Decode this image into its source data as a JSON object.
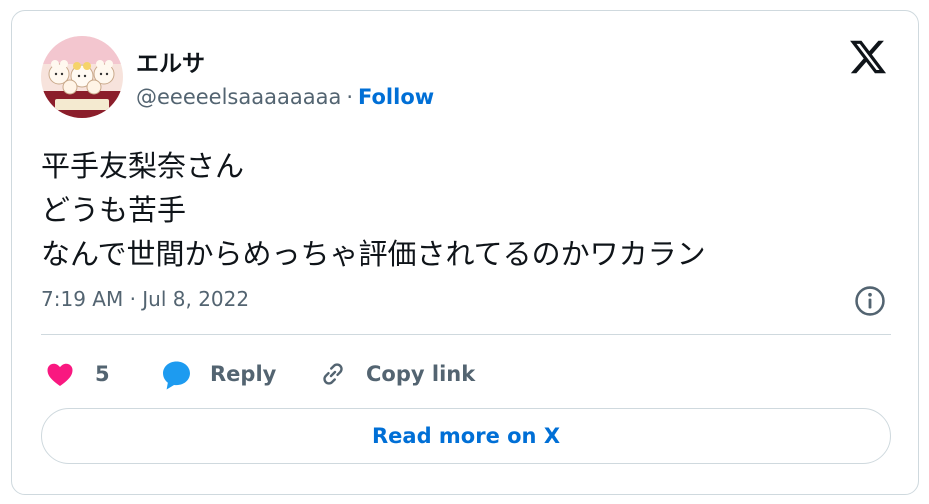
{
  "author": {
    "name": "エルサ",
    "handle": "@eeeeelsaaaaaaaa",
    "separator": "·",
    "follow_label": "Follow",
    "avatar_icon": "illustrated-characters-avatar"
  },
  "tweet": {
    "lines": [
      "平手友梨奈さん",
      "どうも苦手",
      "なんで世間からめっちゃ評価されてるのかワカラン"
    ],
    "timestamp": "7:19 AM · Jul 8, 2022"
  },
  "actions": {
    "like_count": "5",
    "reply_label": "Reply",
    "copy_link_label": "Copy link"
  },
  "read_more_label": "Read more on X",
  "colors": {
    "like": "#f91880",
    "reply": "#1d9bf0",
    "link": "#006fd6",
    "muted": "#536471",
    "border": "#cfd9de"
  }
}
